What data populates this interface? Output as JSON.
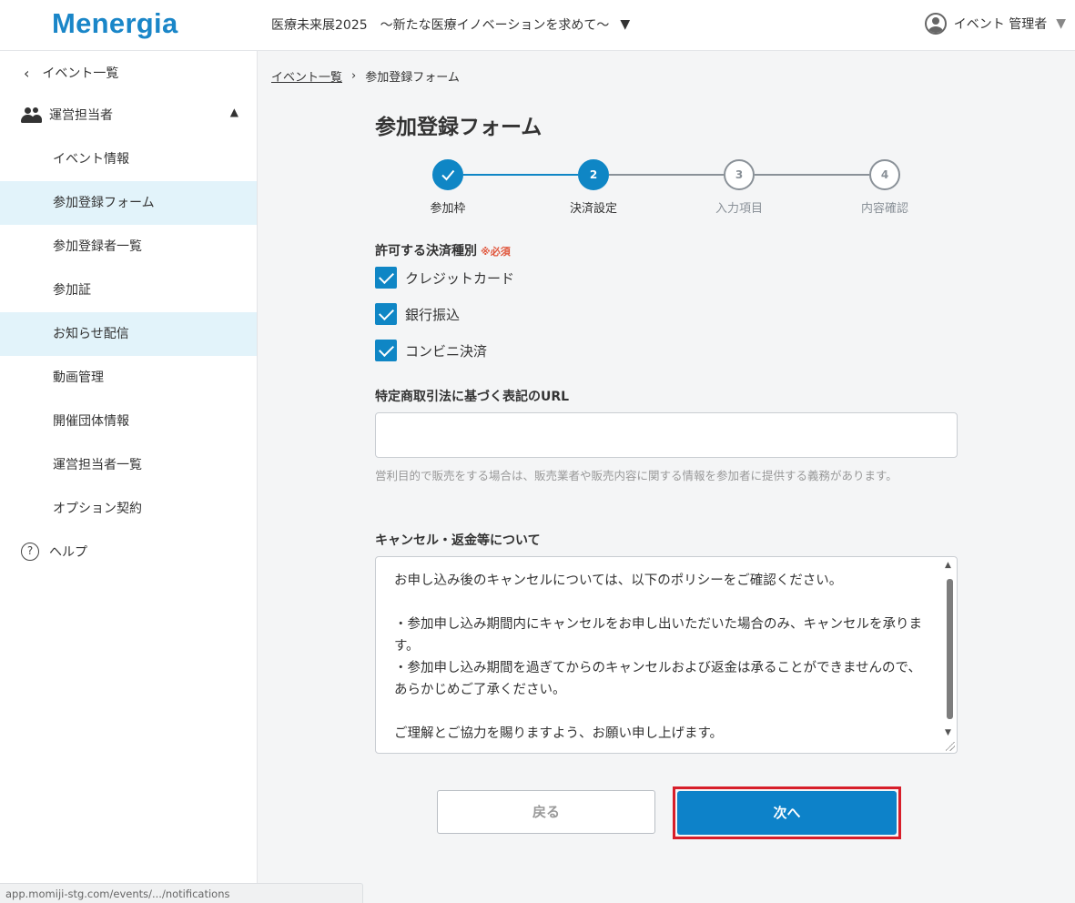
{
  "header": {
    "logo": "Menergia",
    "event_title": "医療未来展2025　〜新たな医療イノベーションを求めて〜",
    "user_name": "イベント 管理者"
  },
  "sidebar": {
    "back_label": "イベント一覧",
    "group_label": "運営担当者",
    "items": [
      {
        "label": "イベント情報",
        "active": false
      },
      {
        "label": "参加登録フォーム",
        "active": true
      },
      {
        "label": "参加登録者一覧",
        "active": false
      },
      {
        "label": "参加証",
        "active": false
      },
      {
        "label": "お知らせ配信",
        "active": true
      },
      {
        "label": "動画管理",
        "active": false
      },
      {
        "label": "開催団体情報",
        "active": false
      },
      {
        "label": "運営担当者一覧",
        "active": false
      },
      {
        "label": "オプション契約",
        "active": false
      }
    ],
    "help_label": "ヘルプ"
  },
  "breadcrumb": {
    "parent": "イベント一覧",
    "current": "参加登録フォーム"
  },
  "page_title": "参加登録フォーム",
  "stepper": {
    "steps": [
      {
        "number": "1",
        "label": "参加枠",
        "state": "done"
      },
      {
        "number": "2",
        "label": "決済設定",
        "state": "current"
      },
      {
        "number": "3",
        "label": "入力項目",
        "state": "todo"
      },
      {
        "number": "4",
        "label": "内容確認",
        "state": "todo"
      }
    ]
  },
  "payment": {
    "label": "許可する決済種別",
    "required": "※必須",
    "options": [
      {
        "label": "クレジットカード",
        "checked": true
      },
      {
        "label": "銀行振込",
        "checked": true
      },
      {
        "label": "コンビニ決済",
        "checked": true
      }
    ]
  },
  "url_field": {
    "label": "特定商取引法に基づく表記のURL",
    "value": "",
    "helper": "営利目的で販売をする場合は、販売業者や販売内容に関する情報を参加者に提供する義務があります。"
  },
  "cancel_policy": {
    "label": "キャンセル・返金等について",
    "lines": [
      "お申し込み後のキャンセルについては、以下のポリシーをご確認ください。",
      "",
      "・参加申し込み期間内にキャンセルをお申し出いただいた場合のみ、キャンセルを承ります。",
      "・参加申し込み期間を過ぎてからのキャンセルおよび返金は承ることができませんので、あらかじめご了承ください。",
      "",
      "ご理解とご協力を賜りますよう、お願い申し上げます。"
    ]
  },
  "buttons": {
    "back": "戻る",
    "next": "次へ"
  },
  "status_bar": "app.momiji-stg.com/events/.../notifications",
  "colors": {
    "brand": "#1a86c8",
    "primary_button": "#0d82c9",
    "active_nav": "#e2f3fa",
    "required": "#e0563c",
    "highlight_frame": "#d71e2a"
  }
}
